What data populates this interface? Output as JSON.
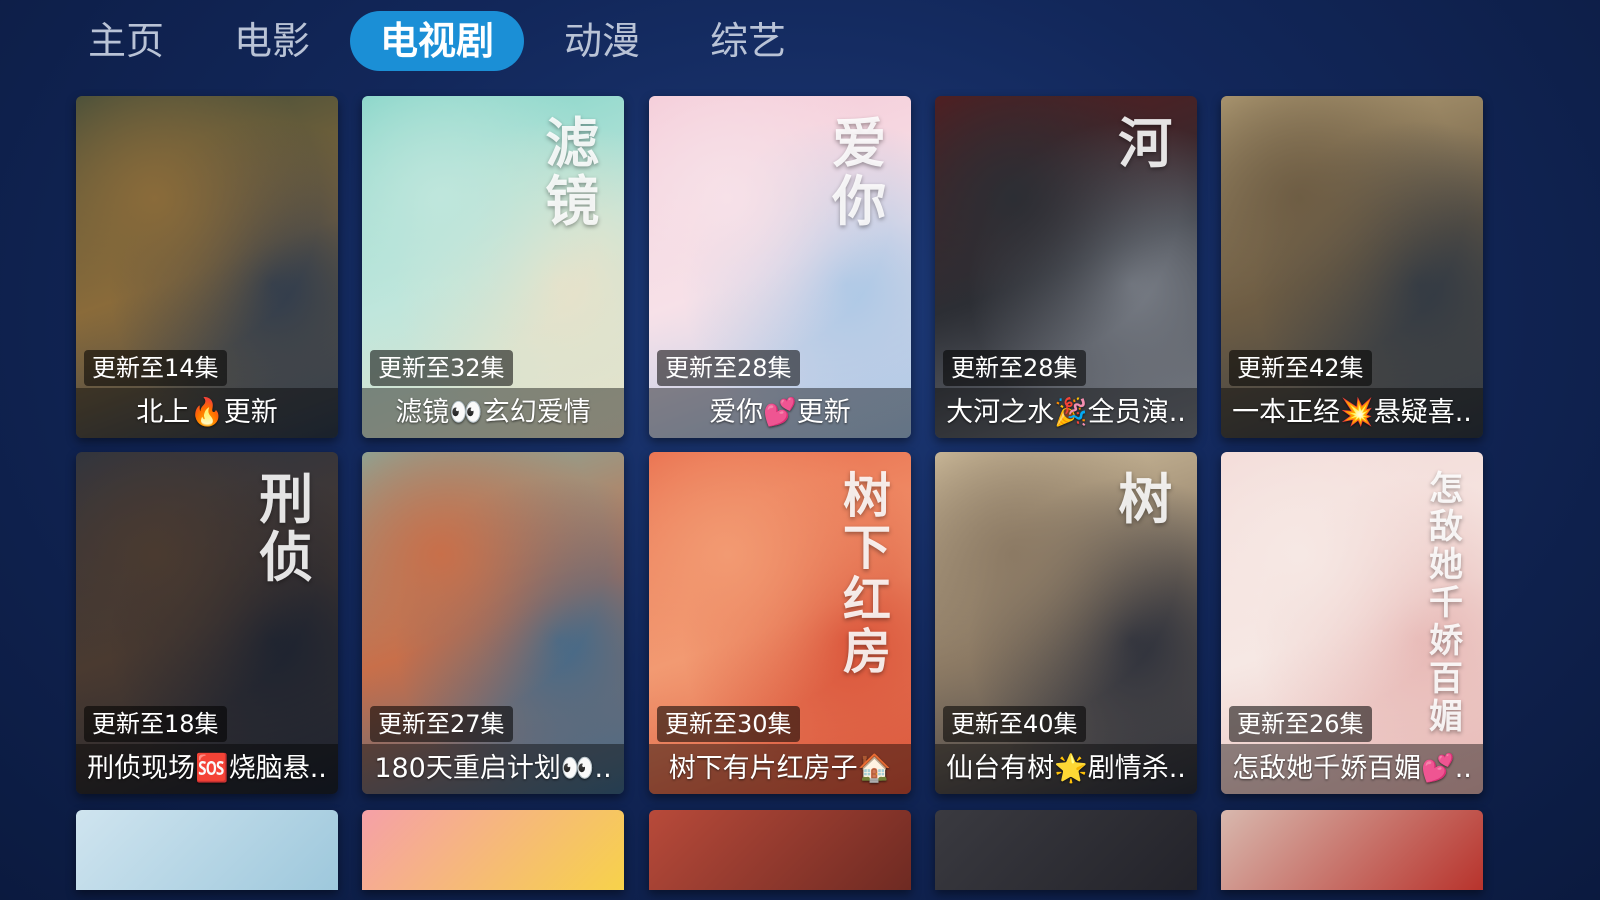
{
  "nav": {
    "tabs": [
      {
        "label": "主页"
      },
      {
        "label": "电影"
      },
      {
        "label": "电视剧",
        "active": true
      },
      {
        "label": "动漫"
      },
      {
        "label": "综艺"
      }
    ]
  },
  "cards": [
    {
      "badge": "更新至14集",
      "title": "北上🔥更新",
      "colors": [
        "#3b4a3a",
        "#8a6b3a",
        "#2c3a4e"
      ]
    },
    {
      "badge": "更新至32集",
      "title": "滤镜👀玄幻爱情",
      "colors": [
        "#7fd3c6",
        "#bfe6dc",
        "#e9e2c9"
      ],
      "poster_text": "滤镜"
    },
    {
      "badge": "更新至28集",
      "title": "爱你💕更新",
      "colors": [
        "#f4c9d6",
        "#f7e1e8",
        "#a9c7e6"
      ],
      "poster_text": "爱你"
    },
    {
      "badge": "更新至28集",
      "title": "大河之水🎉全员演..",
      "colors": [
        "#5a1a1c",
        "#2c2e34",
        "#7a7f88"
      ],
      "poster_text": "河"
    },
    {
      "badge": "更新至42集",
      "title": "一本正经💥悬疑喜..",
      "colors": [
        "#b8a37a",
        "#6e5d44",
        "#2f3844"
      ]
    },
    {
      "badge": "更新至18集",
      "title": "刑侦现场🆘烧脑悬..",
      "colors": [
        "#2a3342",
        "#4a3a30",
        "#1b2230"
      ],
      "poster_text": "刑侦"
    },
    {
      "badge": "更新至27集",
      "title": "180天重启计划👀..",
      "colors": [
        "#7fb0a6",
        "#c86f4a",
        "#3e6a8c"
      ]
    },
    {
      "badge": "更新至30集",
      "title": "树下有片红房子🏠",
      "colors": [
        "#e86a4a",
        "#f29a72",
        "#d95238"
      ],
      "poster_text": "树下红房"
    },
    {
      "badge": "更新至40集",
      "title": "仙台有树🌟剧情杀..",
      "colors": [
        "#d8c6a4",
        "#8c7a64",
        "#2a2e3a"
      ],
      "poster_text": "树"
    },
    {
      "badge": "更新至26集",
      "title": "怎敌她千娇百媚💕..",
      "colors": [
        "#f3d9d6",
        "#f6e8e4",
        "#e7b7b4"
      ],
      "poster_text": "怎敌她千娇百媚"
    }
  ],
  "partial_cards": [
    {
      "colors": [
        "#cfe4ef",
        "#9ec8dc"
      ]
    },
    {
      "colors": [
        "#f5a0a8",
        "#f7d24a"
      ]
    },
    {
      "colors": [
        "#b84a3a",
        "#6e2a22"
      ]
    },
    {
      "colors": [
        "#3a3a40",
        "#23232a"
      ]
    },
    {
      "colors": [
        "#d8b8ae",
        "#b8332c"
      ]
    }
  ]
}
